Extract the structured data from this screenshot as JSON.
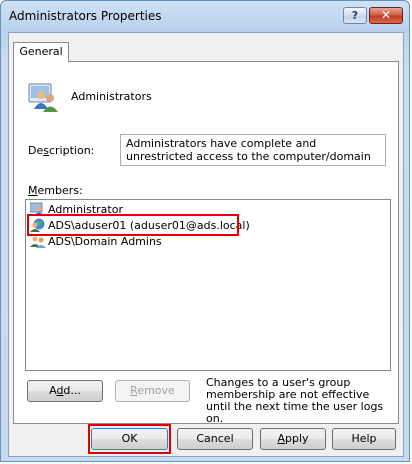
{
  "window": {
    "title": "Administrators Properties",
    "help_glyph": "?",
    "close_glyph": "✕"
  },
  "tabs": [
    {
      "label": "General",
      "selected": true
    }
  ],
  "group": {
    "icon": "user-group-icon",
    "name": "Administrators"
  },
  "description": {
    "label_pre": "De",
    "label_key": "s",
    "label_post": "cription:",
    "value": "Administrators have complete and unrestricted access to the computer/domain"
  },
  "members": {
    "label_key": "M",
    "label_post": "embers:",
    "items": [
      {
        "name": "Administrator",
        "icon": "user-icon"
      },
      {
        "name": "ADS\\aduser01 (aduser01@ads.local)",
        "icon": "domain-user-icon",
        "highlighted": true
      },
      {
        "name": "ADS\\Domain Admins",
        "icon": "domain-group-icon"
      }
    ]
  },
  "buttons": {
    "add": {
      "pre": "A",
      "key": "d",
      "post": "d..."
    },
    "remove": {
      "key": "R",
      "post": "emove"
    },
    "ok": "OK",
    "cancel": "Cancel",
    "apply": {
      "key": "A",
      "post": "pply"
    },
    "help": "Help"
  },
  "note": "Changes to a user's group membership are not effective until the next time the user logs on.",
  "colors": {
    "highlight_border": "#e00000",
    "titlebar": "#b9d2ee",
    "close_button": "#c2381f"
  }
}
